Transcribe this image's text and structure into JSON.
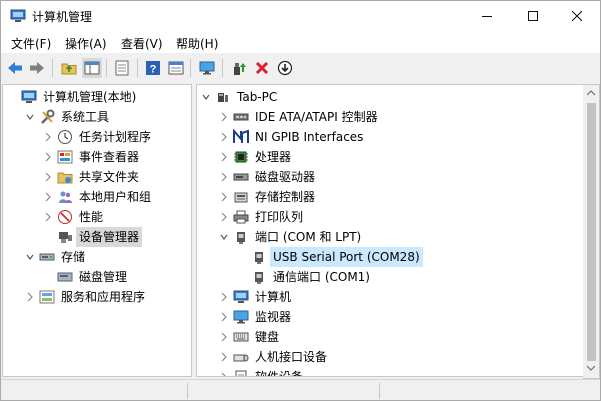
{
  "window": {
    "title": "计算机管理"
  },
  "menus": [
    "文件(F)",
    "操作(A)",
    "查看(V)",
    "帮助(H)"
  ],
  "toolbar": [
    "back-arrow-icon",
    "forward-arrow-icon",
    "up-folder-icon",
    "show-tree-icon",
    "properties-icon",
    "help-icon",
    "console-icon",
    "monitor-icon",
    "update-driver-icon",
    "uninstall-icon",
    "disable-icon"
  ],
  "left_tree": [
    {
      "label": "计算机管理(本地)",
      "name": "tree-computer-management",
      "icon": "computer-management-icon",
      "indent": 0,
      "expander": "",
      "selected": false
    },
    {
      "label": "系统工具",
      "name": "tree-system-tools",
      "icon": "tools-icon",
      "indent": 1,
      "expander": "open",
      "selected": false
    },
    {
      "label": "任务计划程序",
      "name": "tree-task-scheduler",
      "icon": "clock-icon",
      "indent": 2,
      "expander": "closed",
      "selected": false
    },
    {
      "label": "事件查看器",
      "name": "tree-event-viewer",
      "icon": "event-viewer-icon",
      "indent": 2,
      "expander": "closed",
      "selected": false
    },
    {
      "label": "共享文件夹",
      "name": "tree-shared-folders",
      "icon": "shared-folder-icon",
      "indent": 2,
      "expander": "closed",
      "selected": false
    },
    {
      "label": "本地用户和组",
      "name": "tree-local-users",
      "icon": "users-icon",
      "indent": 2,
      "expander": "closed",
      "selected": false
    },
    {
      "label": "性能",
      "name": "tree-performance",
      "icon": "performance-icon",
      "indent": 2,
      "expander": "closed",
      "selected": false
    },
    {
      "label": "设备管理器",
      "name": "tree-device-manager",
      "icon": "device-manager-icon",
      "indent": 2,
      "expander": "",
      "selected": true
    },
    {
      "label": "存储",
      "name": "tree-storage",
      "icon": "storage-icon",
      "indent": 1,
      "expander": "open",
      "selected": false
    },
    {
      "label": "磁盘管理",
      "name": "tree-disk-management",
      "icon": "disk-icon",
      "indent": 2,
      "expander": "",
      "selected": false
    },
    {
      "label": "服务和应用程序",
      "name": "tree-services-apps",
      "icon": "services-icon",
      "indent": 1,
      "expander": "closed",
      "selected": false
    }
  ],
  "right_tree": [
    {
      "label": "Tab-PC",
      "name": "device-root",
      "icon": "pc-icon",
      "indent": 0,
      "expander": "open",
      "selected": false
    },
    {
      "label": "IDE ATA/ATAPI 控制器",
      "name": "device-ide",
      "icon": "ide-controller-icon",
      "indent": 1,
      "expander": "closed",
      "selected": false
    },
    {
      "label": "NI GPIB Interfaces",
      "name": "device-ni-gpib",
      "icon": "ni-logo-icon",
      "indent": 1,
      "expander": "closed",
      "selected": false
    },
    {
      "label": "处理器",
      "name": "device-processors",
      "icon": "cpu-icon",
      "indent": 1,
      "expander": "closed",
      "selected": false
    },
    {
      "label": "磁盘驱动器",
      "name": "device-disk-drives",
      "icon": "disk-drive-icon",
      "indent": 1,
      "expander": "closed",
      "selected": false
    },
    {
      "label": "存储控制器",
      "name": "device-storage-controllers",
      "icon": "storage-controller-icon",
      "indent": 1,
      "expander": "closed",
      "selected": false
    },
    {
      "label": "打印队列",
      "name": "device-print-queues",
      "icon": "printer-icon",
      "indent": 1,
      "expander": "closed",
      "selected": false
    },
    {
      "label": "端口 (COM 和 LPT)",
      "name": "device-ports",
      "icon": "port-icon",
      "indent": 1,
      "expander": "open",
      "selected": false
    },
    {
      "label": "USB Serial Port (COM28)",
      "name": "device-usb-serial",
      "icon": "port-icon",
      "indent": 2,
      "expander": "",
      "selected": true
    },
    {
      "label": "通信端口 (COM1)",
      "name": "device-com1",
      "icon": "port-icon",
      "indent": 2,
      "expander": "",
      "selected": false
    },
    {
      "label": "计算机",
      "name": "device-computer",
      "icon": "computer-icon",
      "indent": 1,
      "expander": "closed",
      "selected": false
    },
    {
      "label": "监视器",
      "name": "device-monitors",
      "icon": "monitor-icon",
      "indent": 1,
      "expander": "closed",
      "selected": false
    },
    {
      "label": "键盘",
      "name": "device-keyboards",
      "icon": "keyboard-icon",
      "indent": 1,
      "expander": "closed",
      "selected": false
    },
    {
      "label": "人机接口设备",
      "name": "device-hid",
      "icon": "hid-icon",
      "indent": 1,
      "expander": "closed",
      "selected": false
    },
    {
      "label": "软件设备",
      "name": "device-software",
      "icon": "software-device-icon",
      "indent": 1,
      "expander": "closed",
      "selected": false
    }
  ]
}
